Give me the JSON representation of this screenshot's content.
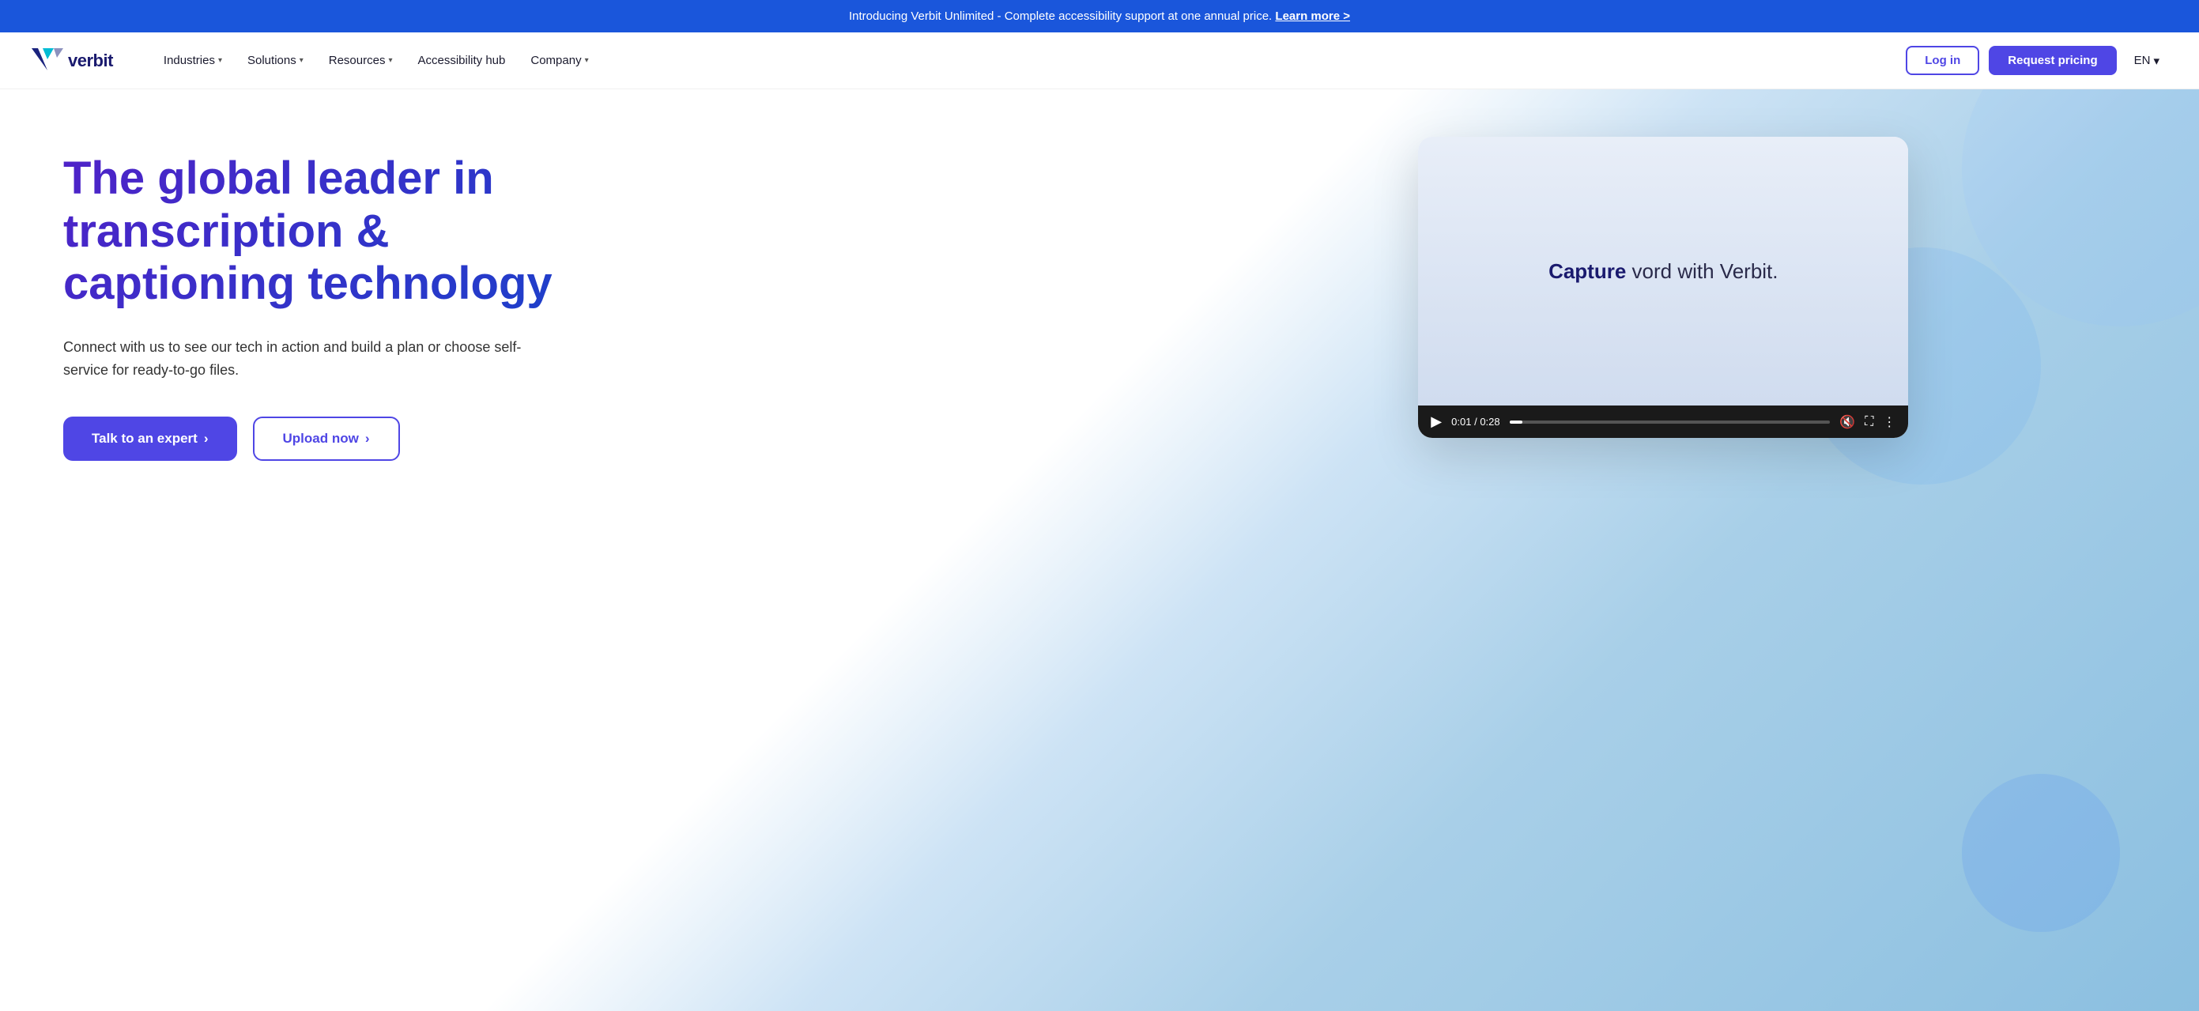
{
  "banner": {
    "text": "Introducing Verbit Unlimited - Complete accessibility support at one annual price.",
    "link_text": "Learn more >",
    "bg_color": "#1a56db"
  },
  "nav": {
    "logo_text": "verbit",
    "items": [
      {
        "label": "Industries",
        "has_dropdown": true
      },
      {
        "label": "Solutions",
        "has_dropdown": true
      },
      {
        "label": "Resources",
        "has_dropdown": true
      },
      {
        "label": "Accessibility hub",
        "has_dropdown": false
      },
      {
        "label": "Company",
        "has_dropdown": true
      }
    ],
    "login_label": "Log in",
    "request_label": "Request pricing",
    "lang_label": "EN"
  },
  "hero": {
    "title": "The global leader in transcription & captioning technology",
    "subtitle": "Connect with us to see our tech in action and build a plan or choose self-service for ready-to-go files.",
    "btn_talk": "Talk to an expert",
    "btn_talk_arrow": "›",
    "btn_upload": "Upload now",
    "btn_upload_arrow": "›"
  },
  "video": {
    "caption_bold": "Capture",
    "caption_rest": " vord with Verbit.",
    "time_current": "0:01",
    "time_total": "0:28"
  }
}
